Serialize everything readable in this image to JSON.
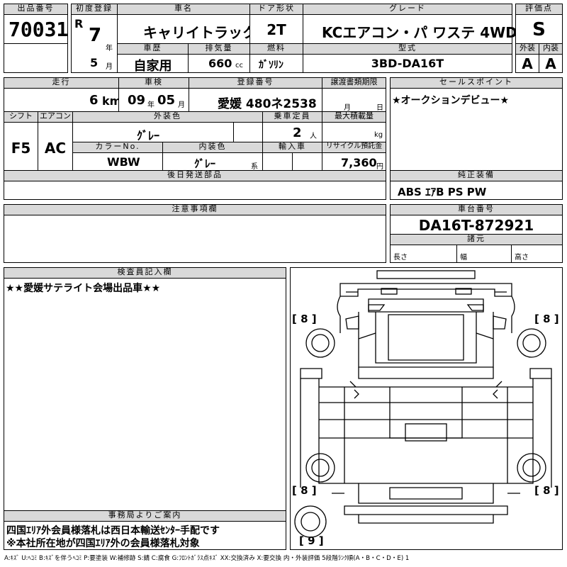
{
  "lot": {
    "label": "出品番号",
    "value": "70031"
  },
  "first_reg": {
    "label": "初度登録",
    "era": "R",
    "year": "7",
    "year_unit": "年",
    "month": "5",
    "month_unit": "月"
  },
  "car_name": {
    "label": "車名",
    "value": "キャリイトラック"
  },
  "doors": {
    "label": "ドア形状",
    "value": "2T"
  },
  "grade": {
    "label": "グレード",
    "value": "KCエアコン・パ ワステ 4WD"
  },
  "score": {
    "label": "評価点",
    "value": "S"
  },
  "history": {
    "label": "車歴",
    "value": "自家用"
  },
  "displacement": {
    "label": "排気量",
    "value": "660",
    "unit": "cc"
  },
  "fuel": {
    "label": "燃料",
    "value": "ｶﾞｿﾘﾝ"
  },
  "model_code": {
    "label": "型式",
    "value": "3BD-DA16T"
  },
  "exterior_grade": {
    "label": "外装",
    "value": "A"
  },
  "interior_grade": {
    "label": "内装",
    "value": "A"
  },
  "mileage": {
    "label": "走行",
    "value": "6",
    "unit": "km"
  },
  "inspection": {
    "label": "車検",
    "year": "09",
    "year_unit": "年",
    "month": "05",
    "month_unit": "月"
  },
  "plate": {
    "label": "登録番号",
    "value": "愛媛 480ネ2538"
  },
  "transfer_docs": {
    "label": "譲渡書類期限",
    "month_unit": "月",
    "day_unit": "日"
  },
  "sales_point": {
    "label": "セールスポイント",
    "text": "★オークションデビュー★"
  },
  "shift": {
    "label": "シフト",
    "value": "F5"
  },
  "aircon": {
    "label": "エアコン",
    "value": "AC"
  },
  "ext_color": {
    "label": "外装色",
    "value": "ｸﾞﾚｰ"
  },
  "capacity": {
    "label": "乗車定員",
    "value": "2",
    "unit": "人"
  },
  "max_load": {
    "label": "最大積載量",
    "unit": "kg"
  },
  "color_no": {
    "label": "カラーNo.",
    "value": "WBW"
  },
  "int_color": {
    "label": "内装色",
    "value": "ｸﾞﾚｰ",
    "suffix": "系"
  },
  "import": {
    "label": "輸入車"
  },
  "recycle": {
    "label": "リサイクル預託金",
    "value": "7,360",
    "unit": "円"
  },
  "later_parts": {
    "label": "後日発送部品"
  },
  "genuine_equipment": {
    "label": "純正装備",
    "value": "ABS ｴｱB PS PW"
  },
  "notes": {
    "label": "注意事項欄"
  },
  "chassis": {
    "label": "車台番号",
    "value": "DA16T-872921"
  },
  "specs": {
    "label": "諸元",
    "length": "長さ",
    "width": "幅",
    "height": "高さ"
  },
  "inspector": {
    "label": "検査員記入欄",
    "text": "★★愛媛サテライト会場出品車★★"
  },
  "office": {
    "label": "事務局よりご案内",
    "line1": "四国ｴﾘｱ外会員様落札は西日本輸送ｾﾝﾀｰ手配です",
    "line2": "※本社所在地が四国ｴﾘｱ外の会員様落札対象"
  },
  "tire_marks": {
    "front_left": "[ 8 ]",
    "front_right": "[ 8 ]",
    "rear_left": "[ 8 ]",
    "rear_right": "[ 8 ]",
    "spare": "[ 9 ]"
  },
  "legend": "A:ｷｽﾞ U:ﾍｺﾐ B:ｷｽﾞを伴うﾍｺﾐ P:要塗装 W:補修跡 S:錆 C:腐食 G:ﾌﾛﾝﾄｶﾞﾗｽ点ｷｽﾞ XX:交換済み X:要交換 内・外装評価 5段階ﾗﾝｸ順(A・B・C・D・E) 1"
}
